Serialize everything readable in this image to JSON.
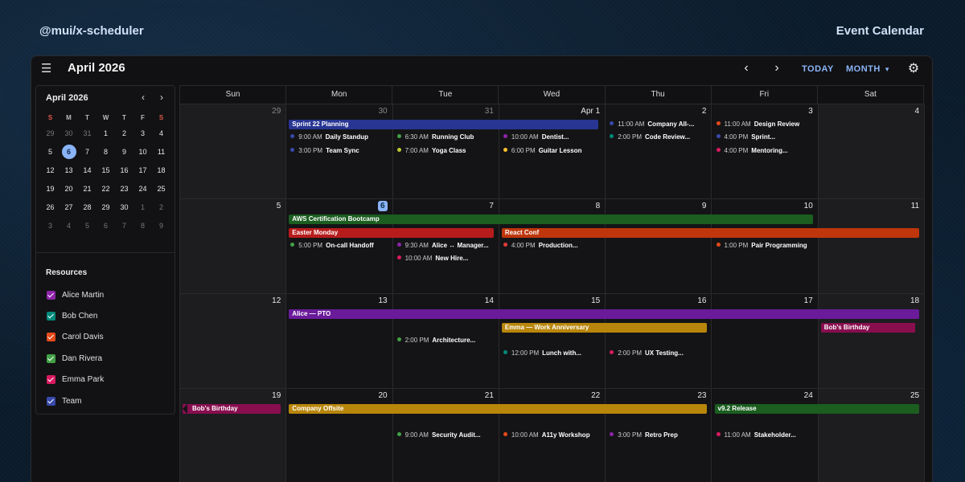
{
  "brand": "@mui/x-scheduler",
  "tagline": "Event Calendar",
  "toolbar": {
    "title": "April 2026",
    "today_label": "TODAY",
    "view_label": "MONTH",
    "menu_icon": "menu-collapse-icon",
    "gear_icon": "gear-icon"
  },
  "mini": {
    "title": "April 2026",
    "dow": [
      "S",
      "M",
      "T",
      "W",
      "T",
      "F",
      "S"
    ],
    "weeks": [
      [
        "29",
        "30",
        "31",
        "1",
        "2",
        "3",
        "4"
      ],
      [
        "5",
        "6",
        "7",
        "8",
        "9",
        "10",
        "11"
      ],
      [
        "12",
        "13",
        "14",
        "15",
        "16",
        "17",
        "18"
      ],
      [
        "19",
        "20",
        "21",
        "22",
        "23",
        "24",
        "25"
      ],
      [
        "26",
        "27",
        "28",
        "29",
        "30",
        "1",
        "2"
      ],
      [
        "3",
        "4",
        "5",
        "6",
        "7",
        "8",
        "9"
      ]
    ]
  },
  "resources": {
    "title": "Resources",
    "items": [
      {
        "label": "Alice Martin",
        "color": "#8e24aa"
      },
      {
        "label": "Bob Chen",
        "color": "#00897b"
      },
      {
        "label": "Carol Davis",
        "color": "#e64a19"
      },
      {
        "label": "Dan Rivera",
        "color": "#43a047"
      },
      {
        "label": "Emma Park",
        "color": "#d81b60"
      },
      {
        "label": "Team",
        "color": "#3949ab"
      }
    ]
  },
  "calendar": {
    "dow": [
      "Sun",
      "Mon",
      "Tue",
      "Wed",
      "Thu",
      "Fri",
      "Sat"
    ],
    "weeks": [
      [
        "29",
        "30",
        "31",
        "Apr 1",
        "2",
        "3",
        "4"
      ],
      [
        "5",
        "6",
        "7",
        "8",
        "9",
        "10",
        "11"
      ],
      [
        "12",
        "13",
        "14",
        "15",
        "16",
        "17",
        "18"
      ],
      [
        "19",
        "20",
        "21",
        "22",
        "23",
        "24",
        "25"
      ]
    ],
    "today": "6",
    "bars": [
      {
        "label": "Sprint 22 Planning",
        "color": "#283593"
      },
      {
        "label": "AWS Certification Bootcamp",
        "color": "#1b5e20"
      },
      {
        "label": "Easter Monday",
        "color": "#b71c1c"
      },
      {
        "label": "React Conf",
        "color": "#bf360c"
      },
      {
        "label": "Alice — PTO",
        "color": "#6a1b9a"
      },
      {
        "label": "Emma — Work Anniversary",
        "color": "#b8860b"
      },
      {
        "label": "Bob's Birthday",
        "color": "#880e4f"
      },
      {
        "label": "Bob's Birthday",
        "color": "#880e4f"
      },
      {
        "label": "Company Offsite",
        "color": "#b8860b"
      },
      {
        "label": "v9.2 Release",
        "color": "#1b5e20"
      }
    ],
    "events": [
      {
        "time": "9:00 AM",
        "name": "Daily Standup",
        "color": "#3949ab"
      },
      {
        "time": "3:00 PM",
        "name": "Team Sync",
        "color": "#3949ab"
      },
      {
        "time": "6:30 AM",
        "name": "Running Club",
        "color": "#43a047"
      },
      {
        "time": "7:00 AM",
        "name": "Yoga Class",
        "color": "#c0ca33"
      },
      {
        "time": "10:00 AM",
        "name": "Dentist...",
        "color": "#8e24aa"
      },
      {
        "time": "6:00 PM",
        "name": "Guitar Lesson",
        "color": "#fbc02d"
      },
      {
        "time": "11:00 AM",
        "name": "Company All-...",
        "color": "#3949ab"
      },
      {
        "time": "2:00 PM",
        "name": "Code Review...",
        "color": "#00897b"
      },
      {
        "time": "11:00 AM",
        "name": "Design Review",
        "color": "#e64a19"
      },
      {
        "time": "4:00 PM",
        "name": "Sprint...",
        "color": "#3949ab"
      },
      {
        "time": "4:00 PM",
        "name": "Mentoring...",
        "color": "#d81b60"
      },
      {
        "time": "5:00 PM",
        "name": "On-call Handoff",
        "color": "#43a047"
      },
      {
        "time": "9:30 AM",
        "name": "Alice ↔ Manager...",
        "color": "#8e24aa"
      },
      {
        "time": "10:00 AM",
        "name": "New Hire...",
        "color": "#d81b60"
      },
      {
        "time": "4:00 PM",
        "name": "Production...",
        "color": "#e53935"
      },
      {
        "time": "1:00 PM",
        "name": "Pair Programming",
        "color": "#e64a19"
      },
      {
        "time": "2:00 PM",
        "name": "Architecture...",
        "color": "#43a047"
      },
      {
        "time": "12:00 PM",
        "name": "Lunch with...",
        "color": "#00897b"
      },
      {
        "time": "2:00 PM",
        "name": "UX Testing...",
        "color": "#d81b60"
      },
      {
        "time": "9:00 AM",
        "name": "Security Audit...",
        "color": "#43a047"
      },
      {
        "time": "10:00 AM",
        "name": "A11y Workshop",
        "color": "#e64a19"
      },
      {
        "time": "3:00 PM",
        "name": "Retro Prep",
        "color": "#8e24aa"
      },
      {
        "time": "11:00 AM",
        "name": "Stakeholder...",
        "color": "#d81b60"
      }
    ]
  }
}
